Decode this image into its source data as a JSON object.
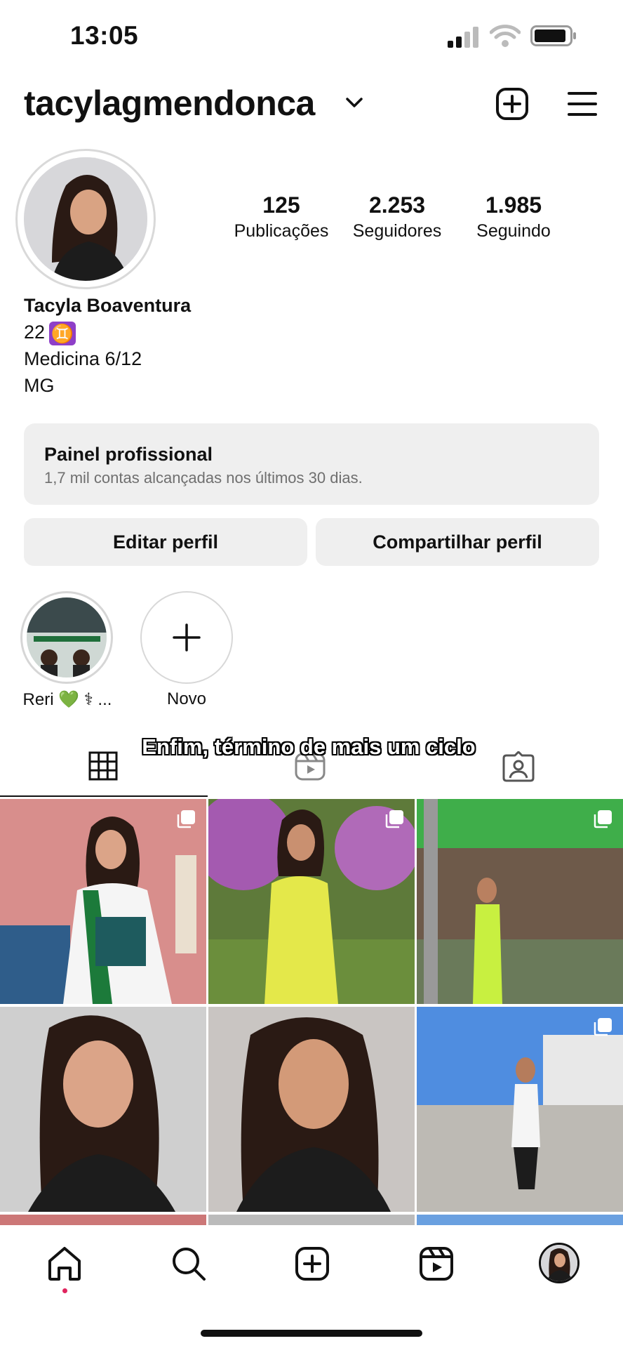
{
  "status_bar": {
    "time": "13:05"
  },
  "header": {
    "username": "tacylagmendonca",
    "add_icon": "plus-square-icon",
    "menu_icon": "hamburger-menu-icon"
  },
  "stats": [
    {
      "value": "125",
      "label": "Publicações"
    },
    {
      "value": "2.253",
      "label": "Seguidores"
    },
    {
      "value": "1.985",
      "label": "Seguindo"
    }
  ],
  "bio": {
    "name": "Tacyla Boaventura",
    "line1": "22",
    "sign": "♊",
    "line2": "Medicina 6/12",
    "line3": "MG"
  },
  "panel": {
    "title": "Painel profissional",
    "subtitle": "1,7 mil contas alcançadas nos últimos 30 dias."
  },
  "buttons": {
    "edit": "Editar perfil",
    "share": "Compartilhar perfil"
  },
  "highlights": [
    {
      "label": "Reri 💚 ⚕ ..."
    },
    {
      "label": "Novo"
    }
  ],
  "caption": "Enfim, término de mais um ciclo",
  "colors": {
    "accent": "#e0245e",
    "surface": "#efefef",
    "text": "#111111",
    "gemini": "#8e3fc8"
  },
  "nav": {
    "icons": [
      "home-icon",
      "search-icon",
      "create-icon",
      "reels-icon",
      "profile-avatar"
    ]
  }
}
